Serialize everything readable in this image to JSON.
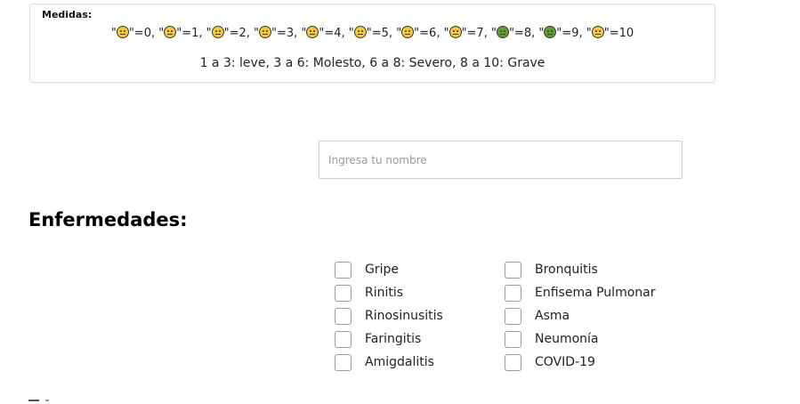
{
  "measures": {
    "title": "Medidas:",
    "scale": [
      {
        "icon": "slightly-smiling-face-icon",
        "text": "\"=0, \""
      },
      {
        "icon": "neutral-face-icon",
        "text": "\"=1, \""
      },
      {
        "icon": "weary-face-icon",
        "text": "\"=2, \""
      },
      {
        "icon": "confounded-face-icon",
        "text": "\"=3, \""
      },
      {
        "icon": "tired-face-icon",
        "text": "\"=4, \""
      },
      {
        "icon": "fearful-face-icon",
        "text": "\"=5, \""
      },
      {
        "icon": "sad-face-icon",
        "text": "\"=6, \""
      },
      {
        "icon": "crying-face-icon",
        "text": "\"=7, \""
      },
      {
        "icon": "vomiting-face-icon",
        "text": "\"=8, \""
      },
      {
        "icon": "nauseated-face-icon",
        "text": "\"=9, \""
      },
      {
        "icon": "dizzy-face-icon",
        "text": "\"=10"
      }
    ],
    "legend": "1 a 3: leve, 3 a 6: Molesto, 6 a 8: Severo, 8 a 10: Grave"
  },
  "name_field": {
    "placeholder": "Ingresa tu nombre",
    "value": ""
  },
  "diseases": {
    "title": "Enfermedades:",
    "columns": [
      [
        {
          "label": "Gripe",
          "checked": false
        },
        {
          "label": "Rinitis",
          "checked": false
        },
        {
          "label": "Rinosinusitis",
          "checked": false
        },
        {
          "label": "Faringitis",
          "checked": false
        },
        {
          "label": "Amigdalitis",
          "checked": false
        }
      ],
      [
        {
          "label": "Bronquitis",
          "checked": false
        },
        {
          "label": "Enfisema Pulmonar",
          "checked": false
        },
        {
          "label": "Asma",
          "checked": false
        },
        {
          "label": "Neumonía",
          "checked": false
        },
        {
          "label": "COVID-19",
          "checked": false
        }
      ]
    ]
  },
  "colors": {
    "emoji_face": "#f6c73b",
    "emoji_face_green": "#5da02e",
    "emoji_face_blue": "#7fb3e6",
    "border": "#dcdcdc"
  }
}
